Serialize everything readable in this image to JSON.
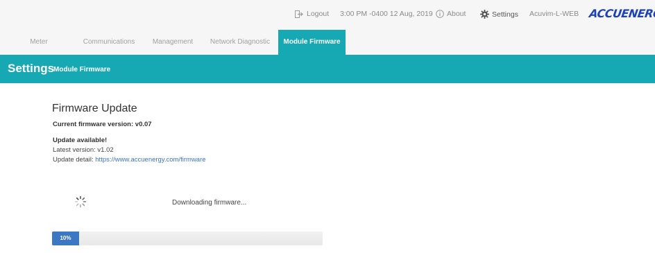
{
  "header": {
    "logout_label": "Logout",
    "datetime": "3:00 PM -0400 12 Aug, 2019",
    "about_label": "About",
    "settings_label": "Settings",
    "device_name": "Acuvim-L-WEB",
    "brand_logo_text": "ACCUENERGY",
    "brand_color": "#1c43b8"
  },
  "tabs": [
    {
      "label": "Meter"
    },
    {
      "label": "Communications"
    },
    {
      "label": "Management"
    },
    {
      "label": "Network Diagnostic"
    },
    {
      "label": "Module Firmware"
    }
  ],
  "active_tab": "Module Firmware",
  "banner": {
    "title": "Settings",
    "subtitle": "Module Firmware",
    "color": "#16a9b4"
  },
  "firmware": {
    "heading": "Firmware Update",
    "current_version": "Current firmware version: v0.07",
    "update_available": "Update available!",
    "latest_version": "Latest version: v1.02",
    "update_detail_label": "Update detail: ",
    "update_detail_link": "https://www.accuenergy.com/firmware",
    "status_text": "Downloading firmware...",
    "progress_label": "10%",
    "progress_fraction": 0.1,
    "progress_color": "#3b77c2"
  }
}
